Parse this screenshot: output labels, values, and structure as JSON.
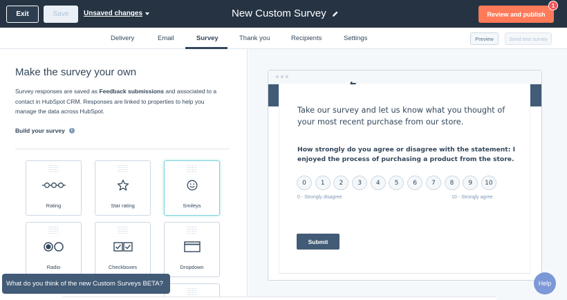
{
  "topbar": {
    "exit_label": "Exit",
    "save_label": "Save",
    "unsaved_label": "Unsaved changes",
    "title": "New Custom Survey",
    "review_label": "Review and publish",
    "notification_count": "1"
  },
  "tabs": [
    {
      "label": "Delivery"
    },
    {
      "label": "Email"
    },
    {
      "label": "Survey"
    },
    {
      "label": "Thank you"
    },
    {
      "label": "Recipients"
    },
    {
      "label": "Settings"
    }
  ],
  "actions": {
    "preview_label": "Preview",
    "send_test_label": "Send test survey"
  },
  "left_panel": {
    "heading": "Make the survey your own",
    "desc_1": "Survey responses are saved as ",
    "desc_bold": "Feedback submissions",
    "desc_2": " and associated to a contact in HubSpot CRM. Responses are linked to properties to help you manage the data across HubSpot.",
    "build_label": "Build your survey",
    "cards": [
      {
        "label": "Rating",
        "icon": "rating-scale-icon"
      },
      {
        "label": "Star rating",
        "icon": "star-icon"
      },
      {
        "label": "Smileys",
        "icon": "smiley-icon"
      },
      {
        "label": "Radio",
        "icon": "radio-icon"
      },
      {
        "label": "Checkboxes",
        "icon": "checkbox-icon"
      },
      {
        "label": "Dropdown",
        "icon": "dropdown-icon"
      }
    ]
  },
  "preview": {
    "intro": "Take our survey and let us know what you thought of your most recent purchase from our store.",
    "question": "How strongly do you agree or disagree with the statement: I enjoyed the process of purchasing a product from the store.",
    "scale": [
      "0",
      "1",
      "2",
      "3",
      "4",
      "5",
      "6",
      "7",
      "8",
      "9",
      "10"
    ],
    "scale_low": "0 - Strongly disagree",
    "scale_high": "10 - Strongly agree",
    "submit_label": "Submit"
  },
  "feedback_prompt": "What do you think of the new Custom Surveys BETA?",
  "help_label": "Help",
  "colors": {
    "topbar": "#253342",
    "accent": "#ff7a59",
    "button_dark": "#425b76"
  }
}
